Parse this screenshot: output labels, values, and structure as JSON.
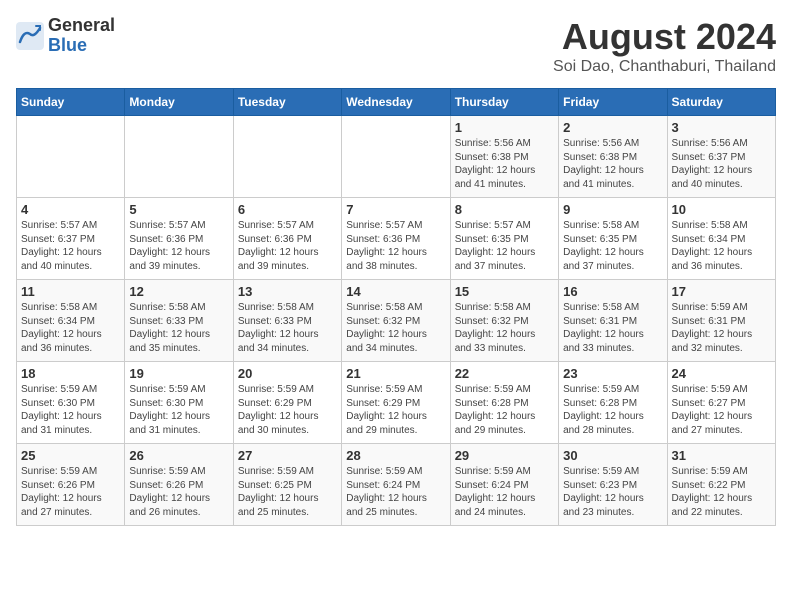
{
  "header": {
    "logo_line1": "General",
    "logo_line2": "Blue",
    "month_title": "August 2024",
    "location": "Soi Dao, Chanthaburi, Thailand"
  },
  "weekdays": [
    "Sunday",
    "Monday",
    "Tuesday",
    "Wednesday",
    "Thursday",
    "Friday",
    "Saturday"
  ],
  "weeks": [
    [
      {
        "day": "",
        "info": ""
      },
      {
        "day": "",
        "info": ""
      },
      {
        "day": "",
        "info": ""
      },
      {
        "day": "",
        "info": ""
      },
      {
        "day": "1",
        "info": "Sunrise: 5:56 AM\nSunset: 6:38 PM\nDaylight: 12 hours\nand 41 minutes."
      },
      {
        "day": "2",
        "info": "Sunrise: 5:56 AM\nSunset: 6:38 PM\nDaylight: 12 hours\nand 41 minutes."
      },
      {
        "day": "3",
        "info": "Sunrise: 5:56 AM\nSunset: 6:37 PM\nDaylight: 12 hours\nand 40 minutes."
      }
    ],
    [
      {
        "day": "4",
        "info": "Sunrise: 5:57 AM\nSunset: 6:37 PM\nDaylight: 12 hours\nand 40 minutes."
      },
      {
        "day": "5",
        "info": "Sunrise: 5:57 AM\nSunset: 6:36 PM\nDaylight: 12 hours\nand 39 minutes."
      },
      {
        "day": "6",
        "info": "Sunrise: 5:57 AM\nSunset: 6:36 PM\nDaylight: 12 hours\nand 39 minutes."
      },
      {
        "day": "7",
        "info": "Sunrise: 5:57 AM\nSunset: 6:36 PM\nDaylight: 12 hours\nand 38 minutes."
      },
      {
        "day": "8",
        "info": "Sunrise: 5:57 AM\nSunset: 6:35 PM\nDaylight: 12 hours\nand 37 minutes."
      },
      {
        "day": "9",
        "info": "Sunrise: 5:58 AM\nSunset: 6:35 PM\nDaylight: 12 hours\nand 37 minutes."
      },
      {
        "day": "10",
        "info": "Sunrise: 5:58 AM\nSunset: 6:34 PM\nDaylight: 12 hours\nand 36 minutes."
      }
    ],
    [
      {
        "day": "11",
        "info": "Sunrise: 5:58 AM\nSunset: 6:34 PM\nDaylight: 12 hours\nand 36 minutes."
      },
      {
        "day": "12",
        "info": "Sunrise: 5:58 AM\nSunset: 6:33 PM\nDaylight: 12 hours\nand 35 minutes."
      },
      {
        "day": "13",
        "info": "Sunrise: 5:58 AM\nSunset: 6:33 PM\nDaylight: 12 hours\nand 34 minutes."
      },
      {
        "day": "14",
        "info": "Sunrise: 5:58 AM\nSunset: 6:32 PM\nDaylight: 12 hours\nand 34 minutes."
      },
      {
        "day": "15",
        "info": "Sunrise: 5:58 AM\nSunset: 6:32 PM\nDaylight: 12 hours\nand 33 minutes."
      },
      {
        "day": "16",
        "info": "Sunrise: 5:58 AM\nSunset: 6:31 PM\nDaylight: 12 hours\nand 33 minutes."
      },
      {
        "day": "17",
        "info": "Sunrise: 5:59 AM\nSunset: 6:31 PM\nDaylight: 12 hours\nand 32 minutes."
      }
    ],
    [
      {
        "day": "18",
        "info": "Sunrise: 5:59 AM\nSunset: 6:30 PM\nDaylight: 12 hours\nand 31 minutes."
      },
      {
        "day": "19",
        "info": "Sunrise: 5:59 AM\nSunset: 6:30 PM\nDaylight: 12 hours\nand 31 minutes."
      },
      {
        "day": "20",
        "info": "Sunrise: 5:59 AM\nSunset: 6:29 PM\nDaylight: 12 hours\nand 30 minutes."
      },
      {
        "day": "21",
        "info": "Sunrise: 5:59 AM\nSunset: 6:29 PM\nDaylight: 12 hours\nand 29 minutes."
      },
      {
        "day": "22",
        "info": "Sunrise: 5:59 AM\nSunset: 6:28 PM\nDaylight: 12 hours\nand 29 minutes."
      },
      {
        "day": "23",
        "info": "Sunrise: 5:59 AM\nSunset: 6:28 PM\nDaylight: 12 hours\nand 28 minutes."
      },
      {
        "day": "24",
        "info": "Sunrise: 5:59 AM\nSunset: 6:27 PM\nDaylight: 12 hours\nand 27 minutes."
      }
    ],
    [
      {
        "day": "25",
        "info": "Sunrise: 5:59 AM\nSunset: 6:26 PM\nDaylight: 12 hours\nand 27 minutes."
      },
      {
        "day": "26",
        "info": "Sunrise: 5:59 AM\nSunset: 6:26 PM\nDaylight: 12 hours\nand 26 minutes."
      },
      {
        "day": "27",
        "info": "Sunrise: 5:59 AM\nSunset: 6:25 PM\nDaylight: 12 hours\nand 25 minutes."
      },
      {
        "day": "28",
        "info": "Sunrise: 5:59 AM\nSunset: 6:24 PM\nDaylight: 12 hours\nand 25 minutes."
      },
      {
        "day": "29",
        "info": "Sunrise: 5:59 AM\nSunset: 6:24 PM\nDaylight: 12 hours\nand 24 minutes."
      },
      {
        "day": "30",
        "info": "Sunrise: 5:59 AM\nSunset: 6:23 PM\nDaylight: 12 hours\nand 23 minutes."
      },
      {
        "day": "31",
        "info": "Sunrise: 5:59 AM\nSunset: 6:22 PM\nDaylight: 12 hours\nand 22 minutes."
      }
    ]
  ]
}
